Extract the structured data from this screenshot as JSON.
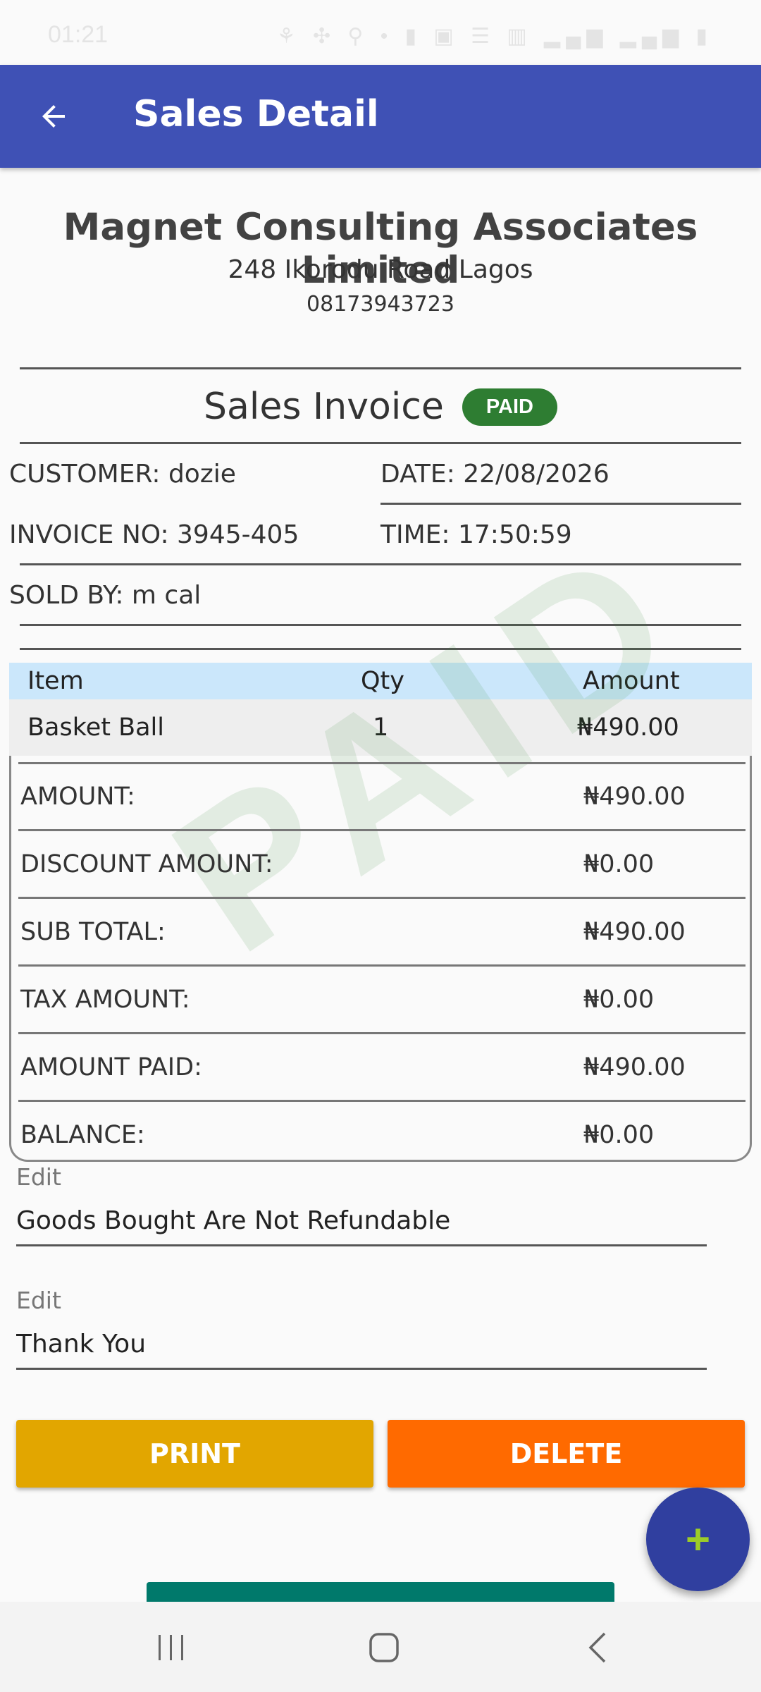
{
  "status_bar": {
    "time": "01:21",
    "icons": "⚘ ✣ ⚲ •   ▮ ▣ ☰ ▥ ▂▄▆ ▂▄▆ ▮"
  },
  "app_bar": {
    "title": "Sales Detail",
    "back_icon": "arrow-left-icon"
  },
  "company": {
    "name": "Magnet Consulting Associates Limited",
    "address": "248 Ikorodu Road Lagos",
    "phone": "08173943723"
  },
  "invoice": {
    "title": "Sales Invoice",
    "status": "PAID",
    "customer": "CUSTOMER: dozie",
    "date": "DATE: 22/08/2026",
    "invoice_no": "INVOICE NO: 3945-405",
    "time": "TIME: 17:50:59",
    "sold_by": "SOLD BY: m cal"
  },
  "table": {
    "headers": {
      "item": "Item",
      "qty": "Qty",
      "amount": "Amount"
    },
    "rows": [
      {
        "item": "Basket Ball",
        "qty": "1",
        "amount": "₦490.00"
      }
    ]
  },
  "summary": [
    {
      "label": "AMOUNT:",
      "value": "₦490.00"
    },
    {
      "label": "DISCOUNT AMOUNT:",
      "value": "₦0.00"
    },
    {
      "label": "SUB TOTAL:",
      "value": "₦490.00"
    },
    {
      "label": "TAX AMOUNT:",
      "value": "₦0.00"
    },
    {
      "label": "AMOUNT PAID:",
      "value": "₦490.00"
    },
    {
      "label": "BALANCE:",
      "value": "₦0.00"
    }
  ],
  "watermark": "PAID",
  "fields": [
    {
      "label": "Edit",
      "value": "Goods Bought Are Not Refundable"
    },
    {
      "label": "Edit",
      "value": "Thank You"
    }
  ],
  "buttons": {
    "print": "PRINT",
    "delete": "DELETE"
  },
  "fab": {
    "symbol": "+",
    "icon": "plus-icon"
  },
  "colors": {
    "app_bar": "#3f51b5",
    "paid_badge": "#2e7d32",
    "print_button": "#e2a600",
    "delete_button": "#ff6a00",
    "fab": "#303f9f",
    "table_header": "#cbe7fb"
  }
}
